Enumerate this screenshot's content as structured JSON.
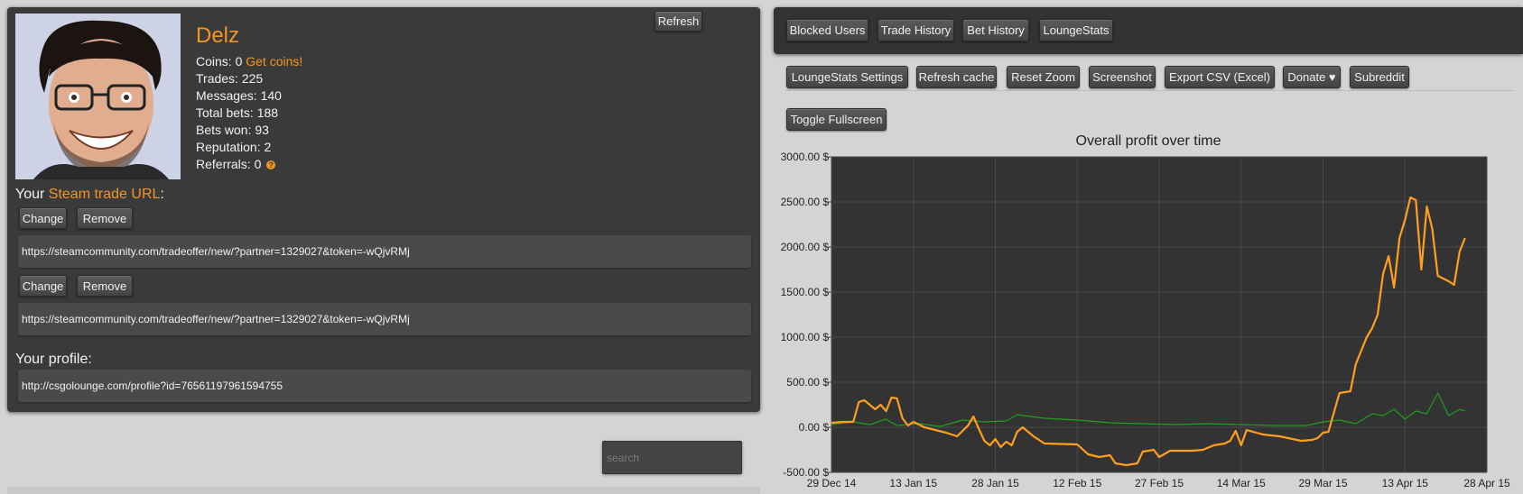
{
  "profile": {
    "refresh_label": "Refresh",
    "username": "Delz",
    "coins_label": "Coins: 0",
    "get_coins_label": "Get coins!",
    "trades": "Trades: 225",
    "messages": "Messages: 140",
    "total_bets": "Total bets: 188",
    "bets_won": "Bets won: 93",
    "reputation": "Reputation: 2",
    "referrals": "Referrals: 0",
    "help_glyph": "?",
    "trade_url_prefix": "Your",
    "trade_url_link": "Steam trade URL",
    "trade_url_suffix": ":",
    "change_label": "Change",
    "remove_label": "Remove",
    "trade_url_1": "https://steamcommunity.com/tradeoffer/new/?partner=1329027&token=-wQjvRMj",
    "trade_url_2": "https://steamcommunity.com/tradeoffer/new/?partner=1329027&token=-wQjvRMj",
    "profile_label": "Your profile:",
    "profile_url": "http://csgolounge.com/profile?id=76561197961594755"
  },
  "search": {
    "placeholder": "search"
  },
  "tabs": [
    "Blocked Users",
    "Trade History",
    "Bet History",
    "LoungeStats"
  ],
  "toolbar": [
    "LoungeStats Settings",
    "Refresh cache",
    "Reset Zoom",
    "Screenshot",
    "Export CSV (Excel)",
    "Donate ♥",
    "Subreddit",
    "Toggle Fullscreen"
  ],
  "colors": {
    "accent": "#f5951f",
    "panel": "#3a3a3a",
    "plot_bg": "#333333",
    "series_profit": "#ff9e1f",
    "series_secondary": "#1e9e1e"
  },
  "chart_data": {
    "type": "line",
    "title": "Overall profit over time",
    "x_ticks": [
      "29 Dec 14",
      "13 Jan 15",
      "28 Jan 15",
      "12 Feb 15",
      "27 Feb 15",
      "14 Mar 15",
      "29 Mar 15",
      "13 Apr 15",
      "28 Apr 15"
    ],
    "y_ticks": [
      "3000.00 $",
      "2500.00 $",
      "2000.00 $",
      "1500.00 $",
      "1000.00 $",
      "500.00 $",
      "0.00 $",
      "-500.00 $"
    ],
    "ylim": [
      -500,
      3000
    ],
    "xlim": [
      "2014-12-29",
      "2015-04-28"
    ],
    "grid": true,
    "legend": "none",
    "series": [
      {
        "color": "#ff9e1f",
        "points": [
          [
            "2014-12-29",
            50
          ],
          [
            "2014-12-31",
            60
          ],
          [
            "2015-01-02",
            60
          ],
          [
            "2015-01-03",
            280
          ],
          [
            "2015-01-04",
            300
          ],
          [
            "2015-01-05",
            250
          ],
          [
            "2015-01-06",
            200
          ],
          [
            "2015-01-07",
            250
          ],
          [
            "2015-01-08",
            180
          ],
          [
            "2015-01-09",
            330
          ],
          [
            "2015-01-10",
            320
          ],
          [
            "2015-01-11",
            100
          ],
          [
            "2015-01-12",
            20
          ],
          [
            "2015-01-13",
            60
          ],
          [
            "2015-01-15",
            0
          ],
          [
            "2015-01-17",
            -30
          ],
          [
            "2015-01-19",
            -60
          ],
          [
            "2015-01-21",
            -100
          ],
          [
            "2015-01-23",
            20
          ],
          [
            "2015-01-24",
            120
          ],
          [
            "2015-01-25",
            -20
          ],
          [
            "2015-01-26",
            -150
          ],
          [
            "2015-01-27",
            -200
          ],
          [
            "2015-01-28",
            -130
          ],
          [
            "2015-01-29",
            -220
          ],
          [
            "2015-01-30",
            -160
          ],
          [
            "2015-01-31",
            -200
          ],
          [
            "2015-02-01",
            -50
          ],
          [
            "2015-02-02",
            0
          ],
          [
            "2015-02-04",
            -100
          ],
          [
            "2015-02-06",
            -180
          ],
          [
            "2015-02-12",
            -190
          ],
          [
            "2015-02-14",
            -300
          ],
          [
            "2015-02-16",
            -330
          ],
          [
            "2015-02-18",
            -310
          ],
          [
            "2015-02-19",
            -400
          ],
          [
            "2015-02-21",
            -420
          ],
          [
            "2015-02-23",
            -400
          ],
          [
            "2015-02-24",
            -270
          ],
          [
            "2015-02-26",
            -250
          ],
          [
            "2015-02-27",
            -330
          ],
          [
            "2015-03-01",
            -260
          ],
          [
            "2015-03-05",
            -260
          ],
          [
            "2015-03-07",
            -250
          ],
          [
            "2015-03-09",
            -200
          ],
          [
            "2015-03-11",
            -180
          ],
          [
            "2015-03-12",
            -150
          ],
          [
            "2015-03-13",
            -40
          ],
          [
            "2015-03-14",
            -200
          ],
          [
            "2015-03-15",
            -30
          ],
          [
            "2015-03-18",
            -80
          ],
          [
            "2015-03-21",
            -100
          ],
          [
            "2015-03-25",
            -150
          ],
          [
            "2015-03-27",
            -140
          ],
          [
            "2015-03-28",
            -120
          ],
          [
            "2015-03-29",
            -60
          ],
          [
            "2015-03-30",
            -50
          ],
          [
            "2015-04-01",
            380
          ],
          [
            "2015-04-03",
            400
          ],
          [
            "2015-04-04",
            700
          ],
          [
            "2015-04-06",
            1000
          ],
          [
            "2015-04-07",
            1100
          ],
          [
            "2015-04-08",
            1250
          ],
          [
            "2015-04-09",
            1700
          ],
          [
            "2015-04-10",
            1900
          ],
          [
            "2015-04-11",
            1550
          ],
          [
            "2015-04-12",
            2100
          ],
          [
            "2015-04-13",
            2300
          ],
          [
            "2015-04-14",
            2550
          ],
          [
            "2015-04-15",
            2520
          ],
          [
            "2015-04-16",
            1750
          ],
          [
            "2015-04-17",
            2450
          ],
          [
            "2015-04-18",
            2200
          ],
          [
            "2015-04-19",
            1680
          ],
          [
            "2015-04-20",
            1650
          ],
          [
            "2015-04-21",
            1620
          ],
          [
            "2015-04-22",
            1580
          ],
          [
            "2015-04-23",
            1950
          ],
          [
            "2015-04-24",
            2100
          ]
        ]
      },
      {
        "color": "#1e9e1e",
        "points": [
          [
            "2014-12-29",
            30
          ],
          [
            "2015-01-02",
            60
          ],
          [
            "2015-01-05",
            30
          ],
          [
            "2015-01-08",
            90
          ],
          [
            "2015-01-10",
            20
          ],
          [
            "2015-01-14",
            40
          ],
          [
            "2015-01-18",
            10
          ],
          [
            "2015-01-22",
            80
          ],
          [
            "2015-01-26",
            60
          ],
          [
            "2015-01-30",
            70
          ],
          [
            "2015-02-01",
            140
          ],
          [
            "2015-02-06",
            100
          ],
          [
            "2015-02-12",
            80
          ],
          [
            "2015-02-18",
            50
          ],
          [
            "2015-02-24",
            40
          ],
          [
            "2015-03-02",
            30
          ],
          [
            "2015-03-08",
            40
          ],
          [
            "2015-03-14",
            30
          ],
          [
            "2015-03-20",
            20
          ],
          [
            "2015-03-26",
            20
          ],
          [
            "2015-03-29",
            60
          ],
          [
            "2015-04-01",
            80
          ],
          [
            "2015-04-04",
            40
          ],
          [
            "2015-04-07",
            150
          ],
          [
            "2015-04-09",
            130
          ],
          [
            "2015-04-11",
            200
          ],
          [
            "2015-04-13",
            90
          ],
          [
            "2015-04-15",
            180
          ],
          [
            "2015-04-17",
            150
          ],
          [
            "2015-04-19",
            380
          ],
          [
            "2015-04-21",
            130
          ],
          [
            "2015-04-23",
            200
          ],
          [
            "2015-04-24",
            180
          ]
        ]
      }
    ]
  }
}
